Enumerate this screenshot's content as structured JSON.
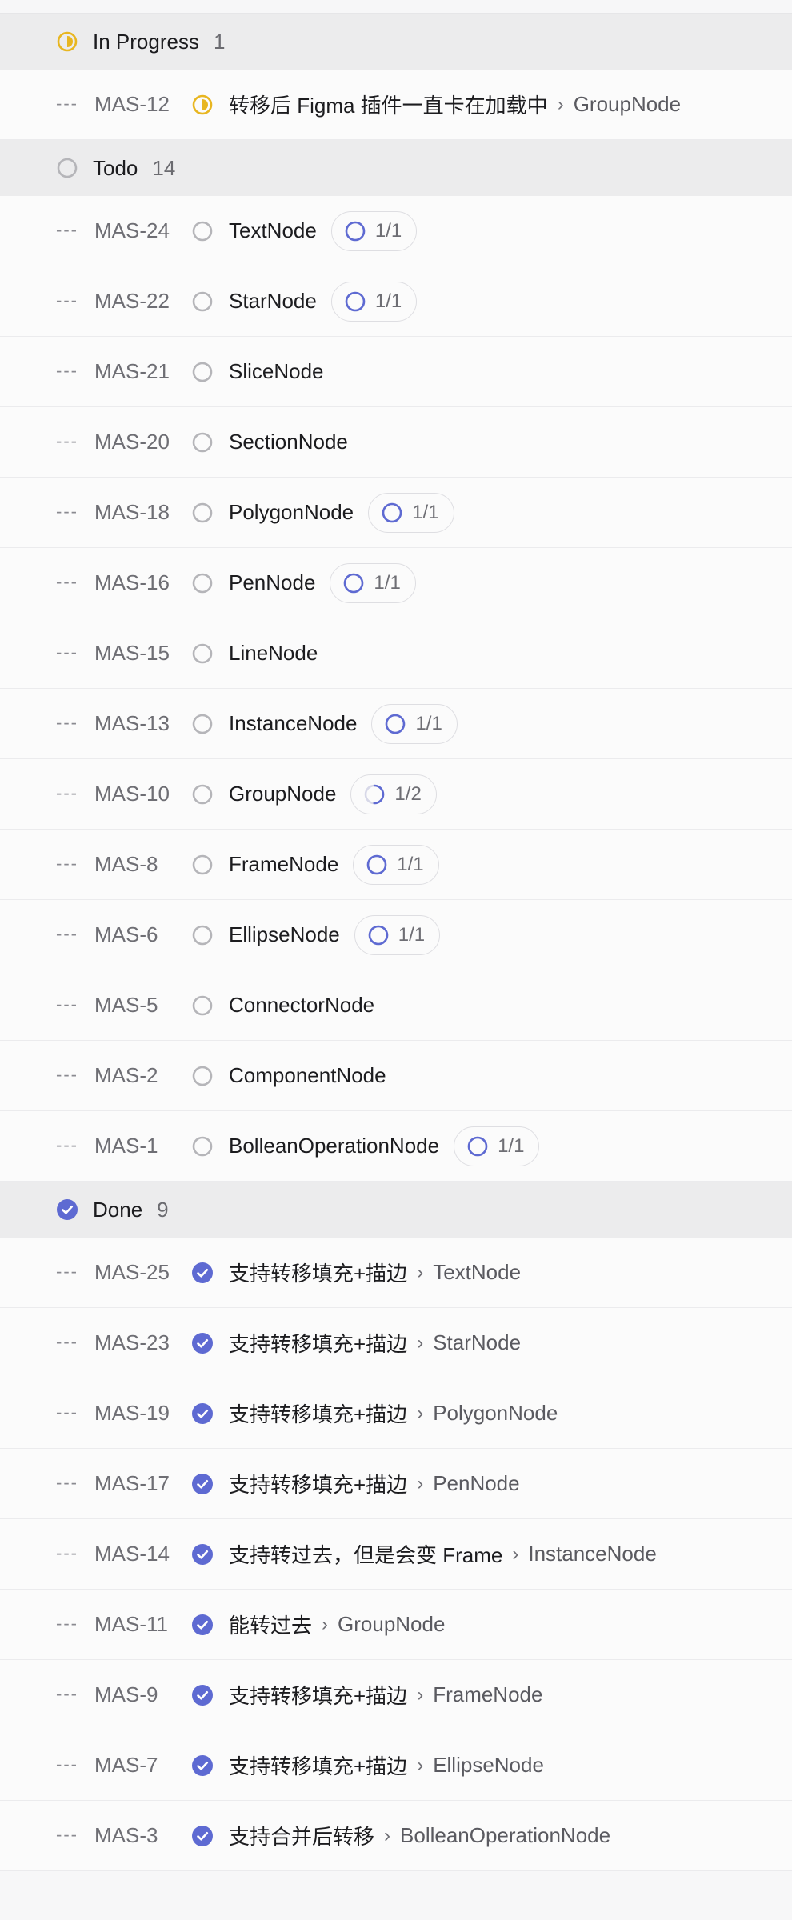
{
  "colors": {
    "in_progress": "#e8b620",
    "todo": "#b5b5b9",
    "done": "#5e6ad2",
    "pill_ring": "#5e6ad2",
    "pill_ring_track": "#d7d8e8"
  },
  "groups": [
    {
      "key": "in_progress",
      "label": "In Progress",
      "count": "1",
      "icon": "in-progress-icon",
      "rows": [
        {
          "id": "MAS-12",
          "title": "转移后 Figma 插件一直卡在加载中",
          "parent": "GroupNode",
          "sub": null
        }
      ]
    },
    {
      "key": "todo",
      "label": "Todo",
      "count": "14",
      "icon": "todo-icon",
      "rows": [
        {
          "id": "MAS-24",
          "title": "TextNode",
          "parent": null,
          "sub": {
            "label": "1/1",
            "progress": 1.0
          }
        },
        {
          "id": "MAS-22",
          "title": "StarNode",
          "parent": null,
          "sub": {
            "label": "1/1",
            "progress": 1.0
          }
        },
        {
          "id": "MAS-21",
          "title": "SliceNode",
          "parent": null,
          "sub": null
        },
        {
          "id": "MAS-20",
          "title": "SectionNode",
          "parent": null,
          "sub": null
        },
        {
          "id": "MAS-18",
          "title": "PolygonNode",
          "parent": null,
          "sub": {
            "label": "1/1",
            "progress": 1.0
          }
        },
        {
          "id": "MAS-16",
          "title": "PenNode",
          "parent": null,
          "sub": {
            "label": "1/1",
            "progress": 1.0
          }
        },
        {
          "id": "MAS-15",
          "title": "LineNode",
          "parent": null,
          "sub": null
        },
        {
          "id": "MAS-13",
          "title": "InstanceNode",
          "parent": null,
          "sub": {
            "label": "1/1",
            "progress": 1.0
          }
        },
        {
          "id": "MAS-10",
          "title": "GroupNode",
          "parent": null,
          "sub": {
            "label": "1/2",
            "progress": 0.5
          }
        },
        {
          "id": "MAS-8",
          "title": "FrameNode",
          "parent": null,
          "sub": {
            "label": "1/1",
            "progress": 1.0
          }
        },
        {
          "id": "MAS-6",
          "title": "EllipseNode",
          "parent": null,
          "sub": {
            "label": "1/1",
            "progress": 1.0
          }
        },
        {
          "id": "MAS-5",
          "title": "ConnectorNode",
          "parent": null,
          "sub": null
        },
        {
          "id": "MAS-2",
          "title": "ComponentNode",
          "parent": null,
          "sub": null
        },
        {
          "id": "MAS-1",
          "title": "BolleanOperationNode",
          "parent": null,
          "sub": {
            "label": "1/1",
            "progress": 1.0
          }
        }
      ]
    },
    {
      "key": "done",
      "label": "Done",
      "count": "9",
      "icon": "done-check-icon",
      "rows": [
        {
          "id": "MAS-25",
          "title": "支持转移填充+描边",
          "parent": "TextNode",
          "sub": null
        },
        {
          "id": "MAS-23",
          "title": "支持转移填充+描边",
          "parent": "StarNode",
          "sub": null
        },
        {
          "id": "MAS-19",
          "title": "支持转移填充+描边",
          "parent": "PolygonNode",
          "sub": null
        },
        {
          "id": "MAS-17",
          "title": "支持转移填充+描边",
          "parent": "PenNode",
          "sub": null
        },
        {
          "id": "MAS-14",
          "title": "支持转过去，但是会变 Frame",
          "parent": "InstanceNode",
          "sub": null
        },
        {
          "id": "MAS-11",
          "title": "能转过去",
          "parent": "GroupNode",
          "sub": null
        },
        {
          "id": "MAS-9",
          "title": "支持转移填充+描边",
          "parent": "FrameNode",
          "sub": null
        },
        {
          "id": "MAS-7",
          "title": "支持转移填充+描边",
          "parent": "EllipseNode",
          "sub": null
        },
        {
          "id": "MAS-3",
          "title": "支持合并后转移",
          "parent": "BolleanOperationNode",
          "sub": null
        }
      ]
    }
  ],
  "row_menu_glyph": "---",
  "parent_separator": "›"
}
